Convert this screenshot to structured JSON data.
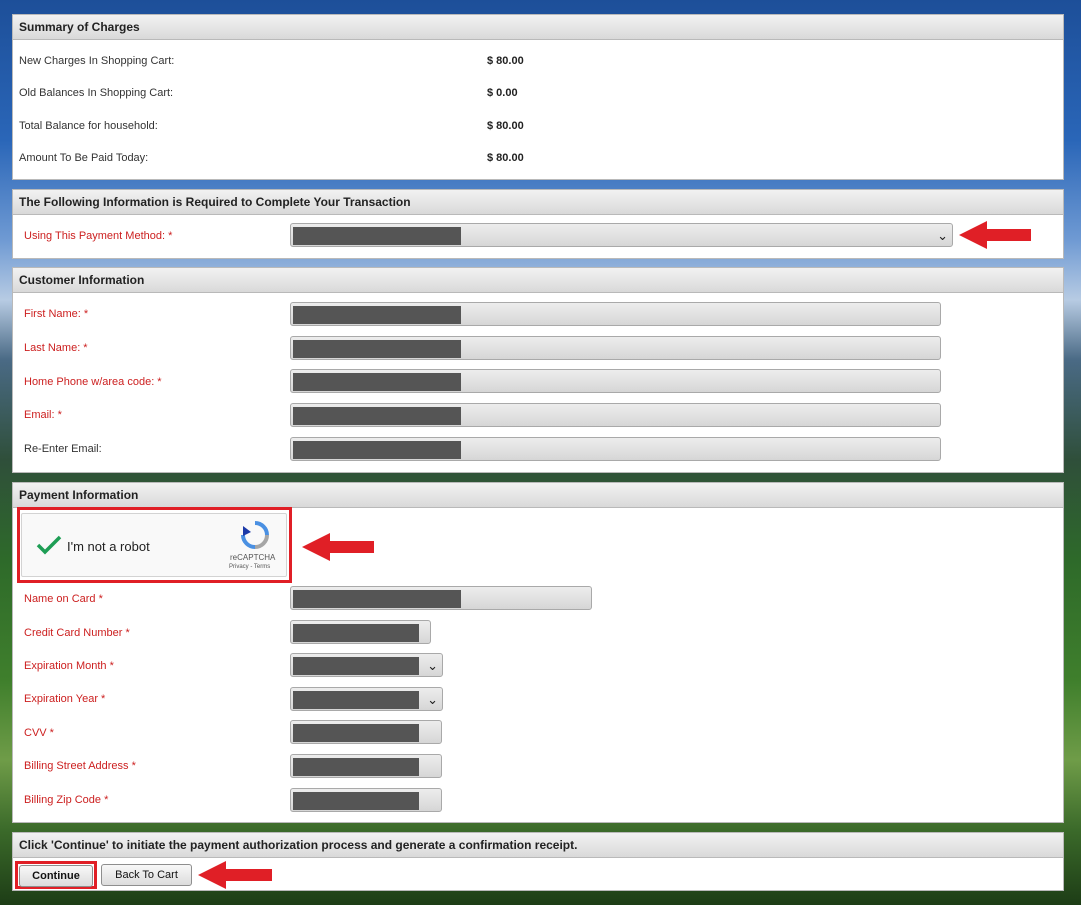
{
  "summary": {
    "title": "Summary of Charges",
    "rows": [
      {
        "label": "New Charges In Shopping Cart:",
        "value": "$ 80.00"
      },
      {
        "label": "Old Balances In Shopping Cart:",
        "value": "$ 0.00"
      },
      {
        "label": "Total Balance for household:",
        "value": "$ 80.00"
      },
      {
        "label": "Amount To Be Paid Today:",
        "value": "$ 80.00"
      }
    ]
  },
  "transaction": {
    "title": "The Following Information is Required to Complete Your Transaction",
    "payment_method_label": "Using This Payment Method: *"
  },
  "customer": {
    "title": "Customer Information",
    "first_name_label": "First Name: *",
    "last_name_label": "Last Name: *",
    "phone_label": "Home Phone w/area code: *",
    "email_label": "Email: *",
    "reenter_email_label": "Re-Enter Email:"
  },
  "payment": {
    "title": "Payment Information",
    "captcha_text": "I'm not a robot",
    "captcha_brand": "reCAPTCHA",
    "captcha_links": "Privacy - Terms",
    "name_on_card_label": "Name on Card *",
    "card_number_label": "Credit Card Number *",
    "exp_month_label": "Expiration Month *",
    "exp_year_label": "Expiration Year *",
    "cvv_label": "CVV *",
    "street_label": "Billing Street Address *",
    "zip_label": "Billing Zip Code *"
  },
  "footer": {
    "instruction": "Click 'Continue' to initiate the payment authorization process and generate a confirmation receipt.",
    "continue_label": "Continue",
    "back_label": "Back To Cart"
  },
  "colors": {
    "required": "#cc1f1f",
    "annotation": "#e01f26",
    "check": "#1e9e55"
  }
}
